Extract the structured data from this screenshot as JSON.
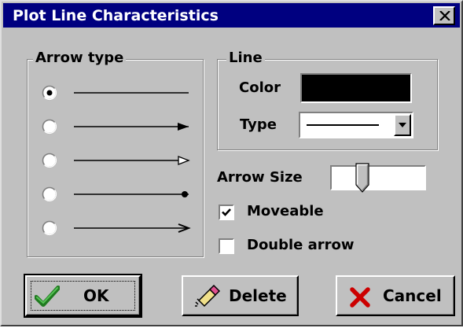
{
  "window": {
    "title": "Plot Line Characteristics",
    "close_icon": "close-icon"
  },
  "arrow_type": {
    "legend": "Arrow type",
    "options": [
      {
        "style": "plain",
        "selected": true
      },
      {
        "style": "filled-arrowhead",
        "selected": false
      },
      {
        "style": "hollow-arrowhead",
        "selected": false
      },
      {
        "style": "dot",
        "selected": false
      },
      {
        "style": "open-arrowhead",
        "selected": false
      }
    ]
  },
  "line": {
    "legend": "Line",
    "color_label": "Color",
    "color_value": "#000000",
    "type_label": "Type",
    "type_value": "solid"
  },
  "arrow_size": {
    "label": "Arrow Size",
    "level": 0.3
  },
  "moveable": {
    "label": "Moveable",
    "checked": true
  },
  "double_arrow": {
    "label": "Double arrow",
    "checked": false
  },
  "buttons": {
    "ok": {
      "label": "OK",
      "icon": "checkmark-icon"
    },
    "delete": {
      "label": "Delete",
      "icon": "eraser-icon"
    },
    "cancel": {
      "label": "Cancel",
      "icon": "x-mark-icon"
    }
  },
  "colors": {
    "titlebar": "#000080",
    "face": "#c0c0c0",
    "ok_icon": "#2e8b2e",
    "cancel_icon": "#cc0000"
  }
}
